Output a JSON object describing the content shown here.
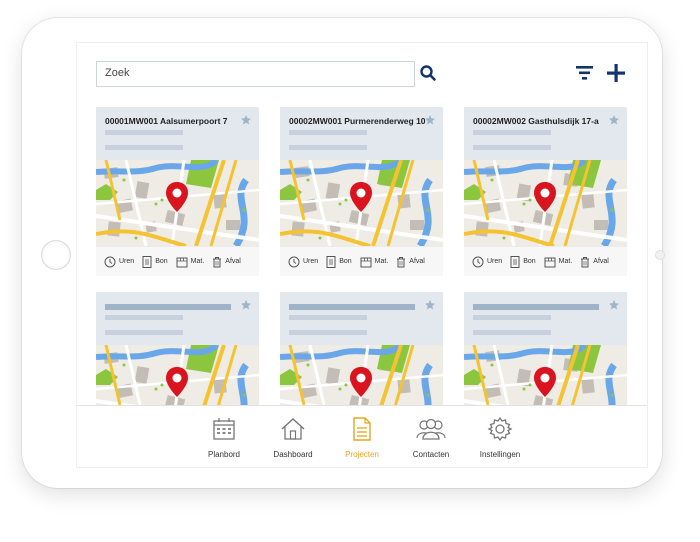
{
  "search": {
    "placeholder": "Zoek"
  },
  "icons": {
    "search": "search-icon",
    "filter": "filter-icon",
    "add": "plus-icon",
    "star": "star-icon",
    "pin": "map-pin-icon"
  },
  "colors": {
    "accent": "#e6a51e",
    "primary": "#13336b",
    "pin": "#d9141e",
    "card_header": "#e3e8ee",
    "placeholder_bar": "#c6d1dd",
    "star": "#9fb4c9"
  },
  "projects": [
    {
      "title": "00001MW001 Aalsumerpoort 7"
    },
    {
      "title": "00002MW001 Purmerenderweg 10"
    },
    {
      "title": "00002MW002 Gasthulsdijk 17-a"
    },
    {
      "title": ""
    },
    {
      "title": ""
    },
    {
      "title": ""
    }
  ],
  "card_actions": {
    "hours": "Uren",
    "receipt": "Bon",
    "material": "Mat.",
    "waste": "Afval"
  },
  "nav": {
    "items": [
      {
        "label": "Planbord",
        "icon": "calendar-icon"
      },
      {
        "label": "Dashboard",
        "icon": "home-icon"
      },
      {
        "label": "Projecten",
        "icon": "document-icon",
        "active": true
      },
      {
        "label": "Contacten",
        "icon": "contacts-icon"
      },
      {
        "label": "Instellingen",
        "icon": "settings-icon"
      }
    ]
  }
}
